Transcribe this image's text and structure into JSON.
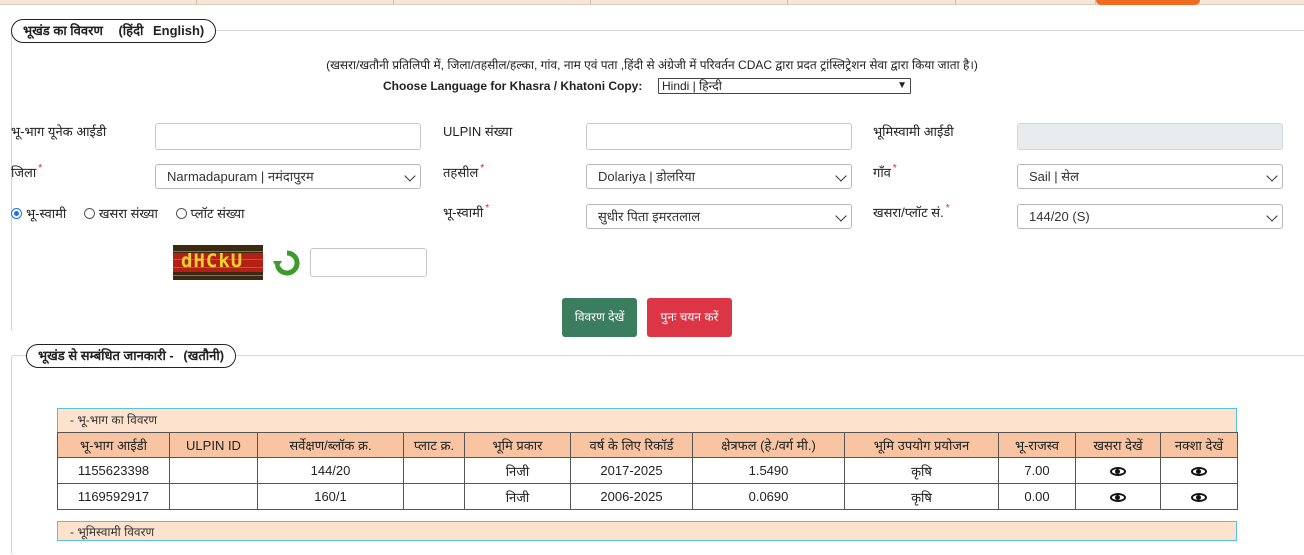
{
  "section1": {
    "title": "भूखंड का विवरण",
    "lang_hindi": "(हिंदी",
    "lang_english": "English)"
  },
  "note": "(खसरा/खतौनी प्रतिलिपी में, जिला/तहसील/हल्का, गांव, नाम एवं पता ,हिंदी से अंग्रेजी में परिवर्तन CDAC द्वारा प्रदत ट्रांस्लिट्रेशन सेवा द्वारा किया जाता है।)",
  "choose_language": {
    "label": "Choose Language for Khasra / Khatoni Copy:",
    "selected": "Hindi | हिन्दी"
  },
  "form": {
    "unique_id_label": "भू-भाग यूनेक आईडी",
    "unique_id_value": "",
    "ulpin_label": "ULPIN संख्या",
    "ulpin_value": "",
    "owner_id_label": "भूमिस्वामी आईडी",
    "owner_id_value": "",
    "district_label": "जिला",
    "district_value": "Narmadapuram | नमंदापुरम",
    "tehsil_label": "तहसील",
    "tehsil_value": "Dolariya | डोलरिया",
    "village_label": "गाँव",
    "village_value": "Sail | सेल",
    "radios": [
      "भू-स्वामी",
      "खसरा संख्या",
      "प्लॉट संख्या"
    ],
    "radio_selected": 0,
    "owner_label": "भू-स्वामी",
    "owner_value": "सुधीर पिता इमरतलाल",
    "khasra_label": "खसरा/प्लॉट सं.",
    "khasra_value": "144/20 (S)",
    "required_mark": "*"
  },
  "captcha": {
    "text": "dHCkU",
    "input_value": ""
  },
  "buttons": {
    "view": "विवरण देखें",
    "reset": "पुनः चयन करें"
  },
  "section2": {
    "title": "भूखंड से सम्बंधित जानकारी -",
    "subtitle": "(खतौनी)"
  },
  "table": {
    "panel_title": "- भू-भाग का विवरण",
    "headers": [
      "भू-भाग आईडी",
      "ULPIN ID",
      "सर्वेक्षण/ब्लॉक क्र.",
      "प्लाट क्र.",
      "भूमि प्रकार",
      "वर्ष के लिए रिकॉर्ड",
      "क्षेत्रफल (हे./वर्ग मी.)",
      "भूमि उपयोग प्रयोजन",
      "भू-राजस्व",
      "खसरा देखें",
      "नक्शा देखें"
    ],
    "rows": [
      [
        "1155623398",
        "",
        "144/20",
        "",
        "निजी",
        "2017-2025",
        "1.5490",
        "कृषि",
        "7.00"
      ],
      [
        "1169592917",
        "",
        "160/1",
        "",
        "निजी",
        "2006-2025",
        "0.0690",
        "कृषि",
        "0.00"
      ]
    ],
    "next_panel_title": "- भूमिस्वामी विवरण"
  },
  "colors": {
    "accent": "#f06a1f",
    "view_button": "#3a7d5f",
    "reset_button": "#dc3545",
    "table_header": "#f9c4a1",
    "panel_head": "#fde3cd",
    "panel_border": "#5bc0de"
  },
  "icons": {
    "refresh": "refresh-icon",
    "view": "eye-icon"
  }
}
